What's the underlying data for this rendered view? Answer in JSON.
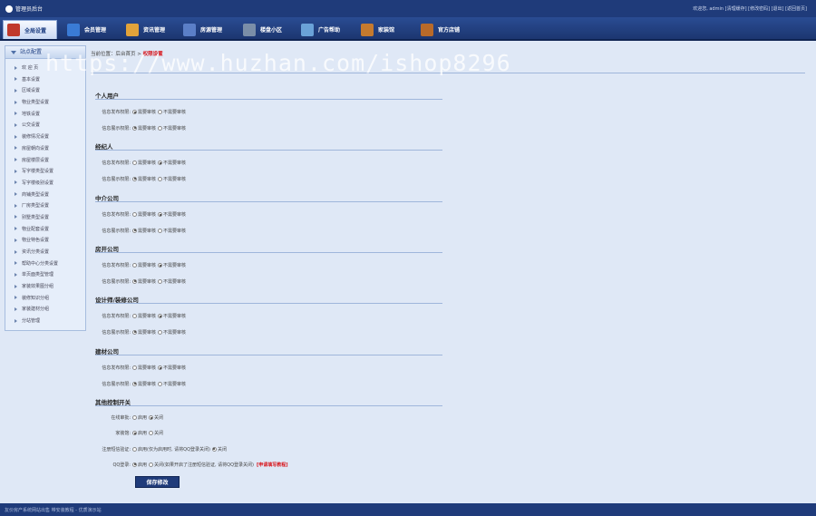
{
  "topbar": {
    "brand": "管理员后台",
    "links_text": "欢迎您, admin [清理缓存] [修改密码] [退出] [返回首页]"
  },
  "nav": [
    {
      "label": "全局设置",
      "color": "#c0392b"
    },
    {
      "label": "会员管理",
      "color": "#3a7bd5"
    },
    {
      "label": "资讯管理",
      "color": "#e2a33a"
    },
    {
      "label": "房源管理",
      "color": "#5b7fc7"
    },
    {
      "label": "楼盘小区",
      "color": "#7a8ea8"
    },
    {
      "label": "广告帮助",
      "color": "#6aa2d8"
    },
    {
      "label": "家装馆",
      "color": "#c57a2e"
    },
    {
      "label": "官方店铺",
      "color": "#b86a2a"
    }
  ],
  "sidebar": {
    "title": "站点配置",
    "items": [
      "欢 迎 页",
      "基本设置",
      "区域设置",
      "物业类型设置",
      "地铁设置",
      "公交设置",
      "装修情况设置",
      "房屋朝向设置",
      "房屋楼层设置",
      "写字楼类型设置",
      "写字楼级别设置",
      "商铺类型设置",
      "厂房类型设置",
      "别墅类型设置",
      "物业配套设置",
      "物业特色设置",
      "资讯分类设置",
      "帮助中心分类设置",
      "单页面类型管理",
      "家装效果图分组",
      "装修知识分组",
      "家装建材分组",
      "分站管理"
    ]
  },
  "crumb": {
    "prefix": "当前位置：后台首页 > ",
    "current": "权限设置"
  },
  "watermark": "https://www.huzhan.com/ishop8296",
  "sections": [
    {
      "title": "个人用户",
      "rows": [
        {
          "label": "信息发布权限:",
          "options": [
            "需要审核",
            "不需要审核"
          ],
          "selected": 0
        },
        {
          "label": "信息展示权限:",
          "options": [
            "需要审核",
            "不需要审核"
          ],
          "selected": 0
        }
      ]
    },
    {
      "title": "经纪人",
      "rows": [
        {
          "label": "信息发布权限:",
          "options": [
            "需要审核",
            "不需要审核"
          ],
          "selected": 1
        },
        {
          "label": "信息展示权限:",
          "options": [
            "需要审核",
            "不需要审核"
          ],
          "selected": 0
        }
      ]
    },
    {
      "title": "中介公司",
      "rows": [
        {
          "label": "信息发布权限:",
          "options": [
            "需要审核",
            "不需要审核"
          ],
          "selected": 1
        },
        {
          "label": "信息展示权限:",
          "options": [
            "需要审核",
            "不需要审核"
          ],
          "selected": 0
        }
      ]
    },
    {
      "title": "房开公司",
      "rows": [
        {
          "label": "信息发布权限:",
          "options": [
            "需要审核",
            "不需要审核"
          ],
          "selected": 1
        },
        {
          "label": "信息展示权限:",
          "options": [
            "需要审核",
            "不需要审核"
          ],
          "selected": 0
        }
      ]
    },
    {
      "title": "设计师/装修公司",
      "rows": [
        {
          "label": "信息发布权限:",
          "options": [
            "需要审核",
            "不需要审核"
          ],
          "selected": 1
        },
        {
          "label": "信息展示权限:",
          "options": [
            "需要审核",
            "不需要审核"
          ],
          "selected": 0
        }
      ]
    },
    {
      "title": "建材公司",
      "rows": [
        {
          "label": "信息发布权限:",
          "options": [
            "需要审核",
            "不需要审核"
          ],
          "selected": 1
        },
        {
          "label": "信息展示权限:",
          "options": [
            "需要审核",
            "不需要审核"
          ],
          "selected": 0
        }
      ]
    },
    {
      "title": "其他控制开关",
      "rows": [
        {
          "label": "在线审批:",
          "options": [
            "启用",
            "关闭"
          ],
          "selected": 1
        },
        {
          "label": "家装馆:",
          "options": [
            "启用",
            "关闭"
          ],
          "selected": 0
        },
        {
          "label": "注册短信验证:",
          "options": [
            "启用(仅为启用时, 请将QQ登录关闭)",
            "关闭"
          ],
          "selected": 1
        },
        {
          "label": "QQ登录:",
          "options": [
            "启用",
            "关闭(如果开启了注册短信验证, 请将QQ登录关闭)"
          ],
          "selected": 0,
          "note": "[申请填写教程]"
        }
      ]
    }
  ],
  "save_label": "保存修改",
  "footer": "友价房产系统网站出售 带安装教程 - 优质演示站"
}
